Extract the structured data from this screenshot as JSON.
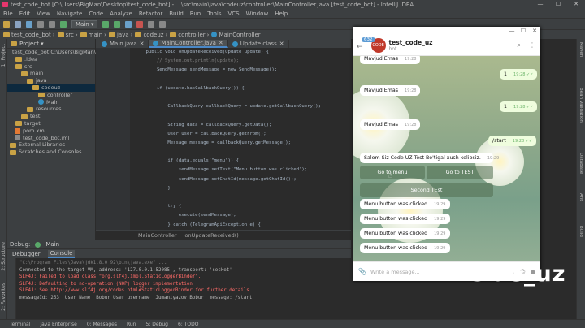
{
  "window": {
    "title": "test_code_bot [C:\\Users\\BigMan\\Desktop\\test_code_bot] - ...\\src\\main\\java\\codeuz\\controller\\MainController.java [test_code_bot] - IntelliJ IDEA",
    "min": "—",
    "max": "☐",
    "close": "✕"
  },
  "menu": [
    "File",
    "Edit",
    "View",
    "Navigate",
    "Code",
    "Analyze",
    "Refactor",
    "Build",
    "Run",
    "Tools",
    "VCS",
    "Window",
    "Help"
  ],
  "toolbar": {
    "run_config": "Main ▾"
  },
  "navbar": [
    "test_code_bot",
    "src",
    "main",
    "java",
    "codeuz",
    "controller",
    "MainController"
  ],
  "project_panel": {
    "title": "Project ▾",
    "tree": [
      {
        "label": "test_code_bot C:\\Users\\BigMan\\D",
        "indent": 0,
        "icon": "folder"
      },
      {
        "label": ".idea",
        "indent": 1,
        "icon": "folder"
      },
      {
        "label": "src",
        "indent": 1,
        "icon": "folder"
      },
      {
        "label": "main",
        "indent": 2,
        "icon": "folder"
      },
      {
        "label": "java",
        "indent": 3,
        "icon": "folder"
      },
      {
        "label": "codeuz",
        "indent": 4,
        "icon": "folder",
        "selected": true
      },
      {
        "label": "controller",
        "indent": 5,
        "icon": "folder"
      },
      {
        "label": "Main",
        "indent": 5,
        "icon": "java"
      },
      {
        "label": "resources",
        "indent": 3,
        "icon": "folder"
      },
      {
        "label": "test",
        "indent": 2,
        "icon": "folder"
      },
      {
        "label": "target",
        "indent": 1,
        "icon": "folder"
      },
      {
        "label": "pom.xml",
        "indent": 1,
        "icon": "xml"
      },
      {
        "label": "test_code_bot.iml",
        "indent": 1,
        "icon": "file"
      },
      {
        "label": "External Libraries",
        "indent": 0,
        "icon": "folder"
      },
      {
        "label": "Scratches and Consoles",
        "indent": 0,
        "icon": "folder"
      }
    ]
  },
  "editor": {
    "tabs": [
      "Main.java",
      "MainController.java",
      "Update.class"
    ],
    "line_numbers": [
      "",
      "",
      "",
      "",
      "",
      "",
      "",
      "",
      "",
      "",
      "",
      "",
      "",
      "",
      "",
      "",
      "",
      "",
      "",
      ""
    ],
    "code": [
      "    public void onUpdateReceived(Update update) {",
      "        // System.out.println(update);",
      "        SendMessage sendMessage = new SendMessage();",
      "",
      "        if (update.hasCallbackQuery()) {",
      "",
      "            CallbackQuery callbackQuery = update.getCallbackQuery();",
      "",
      "            String data = callbackQuery.getData();",
      "            User user = callbackQuery.getFrom();",
      "            Message message = callbackQuery.getMessage();",
      "",
      "            if (data.equals(\"menu\")) {",
      "                sendMessage.setText(\"Menu button was clicked\");",
      "                sendMessage.setChatId(message.getChatId());",
      "            }",
      "",
      "            try {",
      "                execute(sendMessage);",
      "            } catch (TelegramApiException e) {",
      "                e.printStackTrace();",
      "            }",
      "",
      "        }"
    ],
    "breadcrumb": [
      "MainController",
      "onUpdateReceived()"
    ]
  },
  "debug": {
    "label": "Debug:",
    "session": "Main",
    "tabs": [
      "Debugger",
      "Console"
    ],
    "lines": [
      {
        "text": "\"C:\\Program Files\\Java\\jdk1.8.0_92\\bin\\java.exe\" ...",
        "cls": "cm"
      },
      {
        "text": "Connected to the target VM, address: '127.0.0.1:52085', transport: 'socket'",
        "cls": ""
      },
      {
        "text": "SLF4J: Failed to load class \"org.slf4j.impl.StaticLoggerBinder\".",
        "cls": "cred"
      },
      {
        "text": "SLF4J: Defaulting to no-operation (NOP) logger implementation",
        "cls": "cred"
      },
      {
        "text": "SLF4J: See http://www.slf4j.org/codes.html#StaticLoggerBinder for further details.",
        "cls": "cred"
      },
      {
        "text": "messageId: 253  User_Name  Bobur User_username  Jumaniyazov_Bobur  message: /start",
        "cls": ""
      }
    ]
  },
  "statusbar": [
    "Terminal",
    "Java Enterprise",
    "0: Messages",
    "Run",
    "5: Debug",
    "6: TODO"
  ],
  "left_strip": [
    "1: Project",
    "2: Structure",
    "2: Favorites"
  ],
  "right_strip": [
    "Maven",
    "Bean Validation",
    "Database",
    "Ant",
    "Build"
  ],
  "telegram": {
    "unread": "632",
    "bot_name": "test_code_uz",
    "bot_status": "bot",
    "avatar_text": "CODE",
    "messages": [
      {
        "text": "Mavjud Emas",
        "time": "19:28",
        "dir": "in"
      },
      {
        "text": "1",
        "time": "19:28",
        "dir": "out"
      },
      {
        "text": "Mavjud Emas",
        "time": "19:28",
        "dir": "in"
      },
      {
        "text": "1",
        "time": "19:28",
        "dir": "out"
      },
      {
        "text": "Mavjud Emas",
        "time": "19:28",
        "dir": "in"
      },
      {
        "text": "/start",
        "time": "19:28",
        "dir": "out"
      },
      {
        "text": "Salom Siz Code UZ Test Bo'tigal xush kelibsiz.",
        "time": "19:29",
        "dir": "in"
      }
    ],
    "buttons": [
      "Go to menu",
      "Go to TEST",
      "Second TEst"
    ],
    "clicked": [
      {
        "text": "Menu button was clicked",
        "time": "19:29"
      },
      {
        "text": "Menu button was clicked",
        "time": "19:29"
      },
      {
        "text": "Menu button was clicked",
        "time": "19:29"
      },
      {
        "text": "Menu button was clicked",
        "time": "19:29"
      }
    ],
    "composer_placeholder": "Write a message...",
    "read_marks": "✓✓"
  },
  "watermark": {
    "text": "c de_uz"
  }
}
